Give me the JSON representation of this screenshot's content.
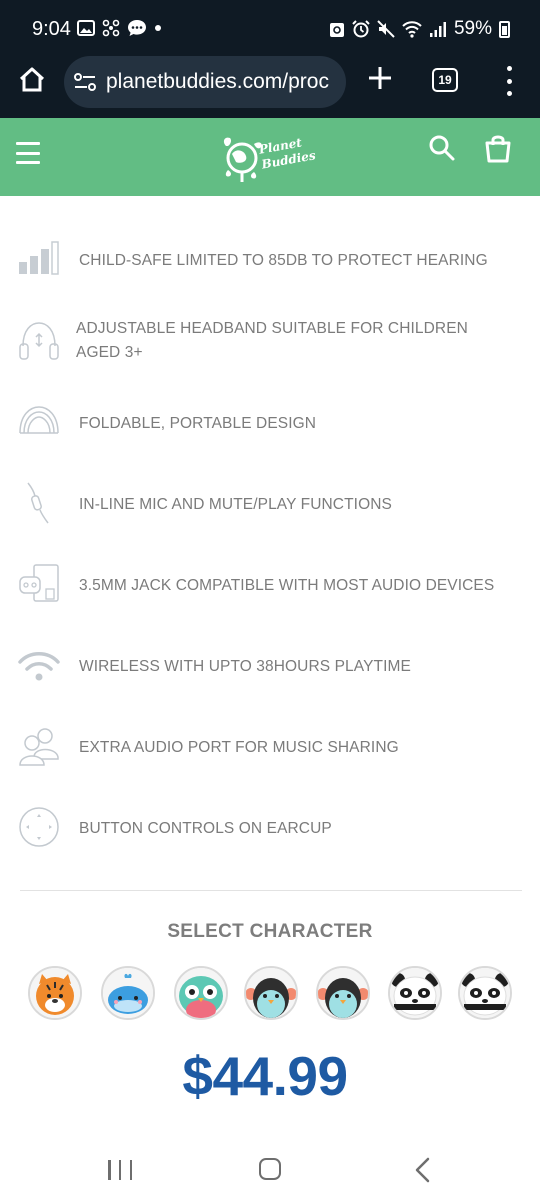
{
  "status_bar": {
    "time": "9:04",
    "battery": "59%"
  },
  "browser": {
    "url": "planetbuddies.com/proc",
    "tab_count": "19",
    "accent": "#0f1a24"
  },
  "site": {
    "brand_line1": "Planet",
    "brand_line2": "Buddies",
    "header_color": "#62bd84"
  },
  "features": [
    {
      "icon": "volume-bars-icon",
      "text": "CHILD-SAFE LIMITED TO 85DB TO PROTECT HEARING"
    },
    {
      "icon": "adjustable-headband-icon",
      "text": "ADJUSTABLE HEADBAND SUITABLE FOR CHILDREN AGED 3+"
    },
    {
      "icon": "foldable-headphones-icon",
      "text": "FOLDABLE, PORTABLE DESIGN"
    },
    {
      "icon": "inline-mic-icon",
      "text": "IN-LINE MIC AND MUTE/PLAY FUNCTIONS"
    },
    {
      "icon": "devices-icon",
      "text": "3.5MM JACK COMPATIBLE WITH MOST AUDIO DEVICES"
    },
    {
      "icon": "wireless-icon",
      "text": "WIRELESS WITH UPTO 38HOURS PLAYTIME"
    },
    {
      "icon": "users-icon",
      "text": "EXTRA AUDIO PORT FOR MUSIC SHARING"
    },
    {
      "icon": "button-controls-icon",
      "text": "BUTTON CONTROLS ON EARCUP"
    }
  ],
  "product": {
    "select_title": "SELECT CHARACTER",
    "characters": [
      "tiger",
      "whale",
      "owl",
      "penguin-red",
      "penguin-blue",
      "panda",
      "panda-2"
    ],
    "price": "$44.99",
    "price_color": "#1e5aa3"
  }
}
